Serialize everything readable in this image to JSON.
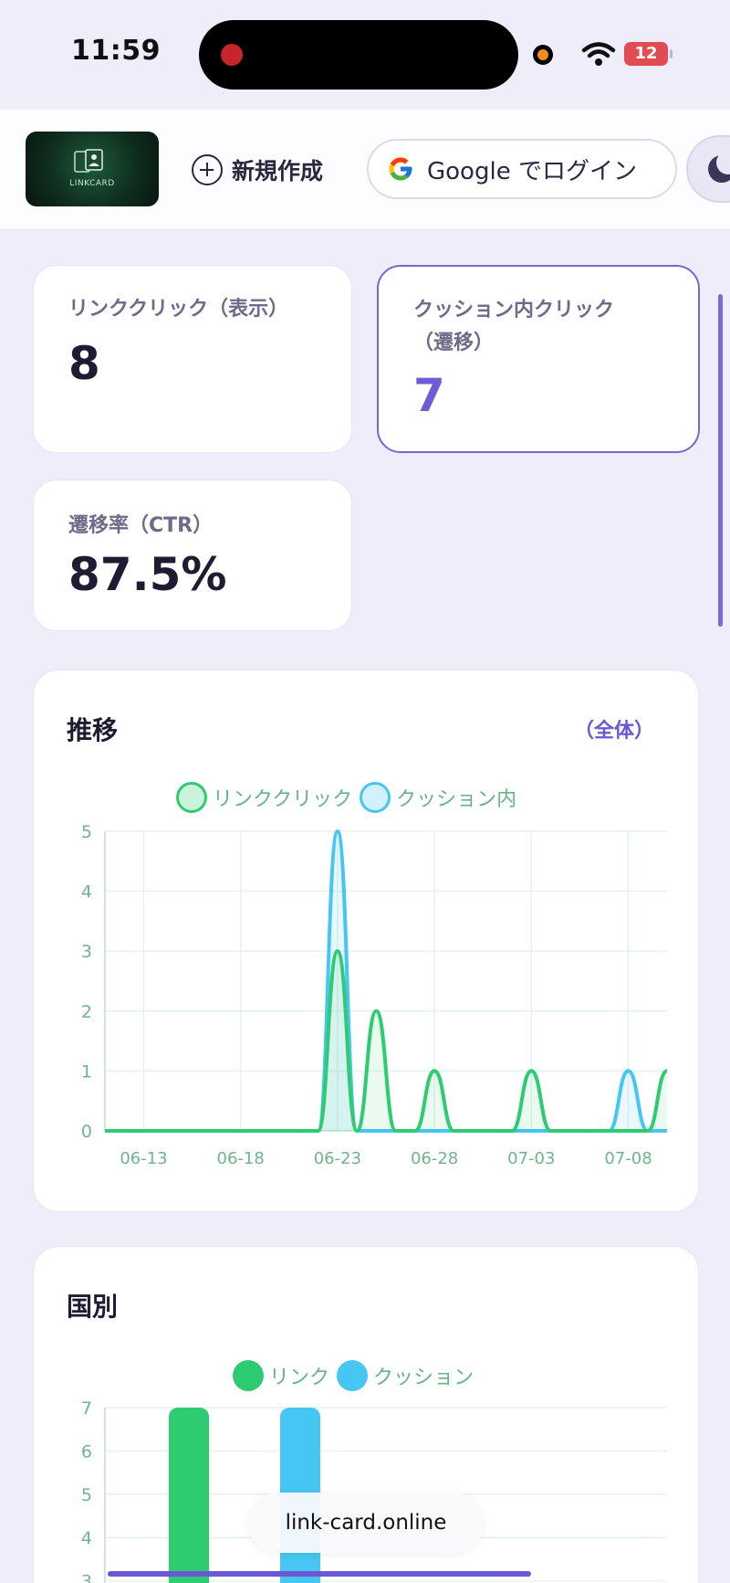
{
  "status_bar": {
    "time": "11:59",
    "battery": "12"
  },
  "header": {
    "logo_text": "LINKCARD",
    "new_label": "新規作成",
    "google_label": "Google でログイン"
  },
  "stats": {
    "link_clicks": {
      "label": "リンククリック（表示）",
      "value": "8"
    },
    "cushion_clicks": {
      "label_line1": "クッション内クリック",
      "label_line2": "（遷移）",
      "value": "7"
    },
    "ctr": {
      "label": "遷移率（CTR）",
      "value": "87.5%"
    }
  },
  "trend": {
    "title": "推移",
    "scope": "（全体）"
  },
  "country": {
    "title": "国別"
  },
  "footer": {
    "url": "link-card.online"
  },
  "colors": {
    "accent": "#6f5bd6",
    "link_series": "#2ecc71",
    "cushion_series": "#46c6f2"
  },
  "chart_data": [
    {
      "type": "line",
      "x": [
        "06-11",
        "06-12",
        "06-13",
        "06-14",
        "06-15",
        "06-16",
        "06-17",
        "06-18",
        "06-19",
        "06-20",
        "06-21",
        "06-22",
        "06-23",
        "06-24",
        "06-25",
        "06-26",
        "06-27",
        "06-28",
        "06-29",
        "06-30",
        "07-01",
        "07-02",
        "07-03",
        "07-04",
        "07-05",
        "07-06",
        "07-07",
        "07-08",
        "07-09",
        "07-10"
      ],
      "x_ticks": [
        "06-13",
        "06-18",
        "06-23",
        "06-28",
        "07-03",
        "07-08"
      ],
      "series": [
        {
          "name": "リンククリック",
          "color": "#2ecc71",
          "values": [
            0,
            0,
            0,
            0,
            0,
            0,
            0,
            0,
            0,
            0,
            0,
            0,
            3,
            0,
            2,
            0,
            0,
            1,
            0,
            0,
            0,
            0,
            1,
            0,
            0,
            0,
            0,
            0,
            0,
            1
          ]
        },
        {
          "name": "クッション内",
          "color": "#46c6f2",
          "values": [
            0,
            0,
            0,
            0,
            0,
            0,
            0,
            0,
            0,
            0,
            0,
            0,
            5,
            0,
            0,
            0,
            0,
            0,
            0,
            0,
            0,
            0,
            0,
            0,
            0,
            0,
            0,
            1,
            0,
            0
          ]
        }
      ],
      "ylim": [
        0,
        5
      ],
      "y_ticks": [
        0,
        1,
        2,
        3,
        4,
        5
      ],
      "grid": true,
      "legend": "top-center"
    },
    {
      "type": "bar",
      "series": [
        {
          "name": "リンク",
          "color": "#2ecc71",
          "values": [
            7
          ]
        },
        {
          "name": "クッション",
          "color": "#46c6f2",
          "values": [
            7
          ]
        }
      ],
      "y_ticks": [
        3,
        4,
        5,
        6,
        7
      ],
      "ylim": [
        0,
        7
      ],
      "grid": true,
      "legend": "top-center"
    }
  ]
}
